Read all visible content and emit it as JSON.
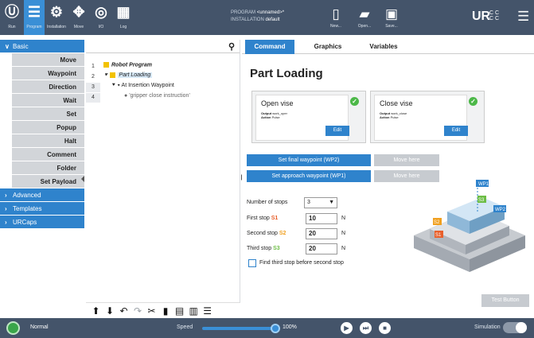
{
  "topbar": {
    "nav": [
      {
        "label": "Run",
        "icon": "ur-logo-icon",
        "glyph": "Ⓤ"
      },
      {
        "label": "Program",
        "icon": "program-icon",
        "glyph": "☰"
      },
      {
        "label": "Installation",
        "icon": "installation-icon",
        "glyph": "⚙"
      },
      {
        "label": "Move",
        "icon": "move-icon",
        "glyph": "✥"
      },
      {
        "label": "I/O",
        "icon": "io-icon",
        "glyph": "◎"
      },
      {
        "label": "Log",
        "icon": "log-icon",
        "glyph": "▦"
      }
    ],
    "program_label": "PROGRAM",
    "program_value": "<unnamed>*",
    "installation_label": "INSTALLATION",
    "installation_value": "default",
    "file_buttons": [
      {
        "label": "New...",
        "glyph": "▯"
      },
      {
        "label": "Open...",
        "glyph": "▰"
      },
      {
        "label": "Save...",
        "glyph": "▣"
      }
    ],
    "logo": "UR",
    "cc": "C C\nC C"
  },
  "sidebar": {
    "basic_label": "Basic",
    "commands": [
      "Move",
      "Waypoint",
      "Direction",
      "Wait",
      "Set",
      "Popup",
      "Halt",
      "Comment",
      "Folder",
      "Set Payload"
    ],
    "categories": [
      "Advanced",
      "Templates",
      "URCaps"
    ]
  },
  "tree": {
    "lines": [
      {
        "num": "1",
        "text": "Robot Program"
      },
      {
        "num": "2",
        "text": "Part Loading"
      },
      {
        "num": "3",
        "text": "At Insertion Waypoint"
      },
      {
        "num": "4",
        "text": "'gripper close instruction'"
      }
    ]
  },
  "tabs": [
    "Command",
    "Graphics",
    "Variables"
  ],
  "main": {
    "title": "Part Loading",
    "cards": [
      {
        "name": "Open vise",
        "output_label": "Output",
        "output_value": "work_oper",
        "action_label": "Action",
        "action_value": "Pulse",
        "edit_label": "Edit"
      },
      {
        "name": "Close vise",
        "output_label": "Output",
        "output_value": "work_close",
        "action_label": "Action",
        "action_value": "Pulse",
        "edit_label": "Edit"
      }
    ],
    "set_final_label": "Set final waypoint (WP2)",
    "set_approach_label": "Set approach waypoint (WP1)",
    "move_here_label": "Move here",
    "num_stops_label": "Number of stops",
    "num_stops_value": "3",
    "first_stop_label": "First stop",
    "first_stop_tag": "S1",
    "first_stop_value": "10",
    "second_stop_label": "Second stop",
    "second_stop_tag": "S2",
    "second_stop_value": "20",
    "third_stop_label": "Third stop",
    "third_stop_tag": "S3",
    "third_stop_value": "20",
    "unit": "N",
    "checkbox_label": "Find third stop before second stop",
    "test_button": "Test Button",
    "diagram_tags": {
      "wp1": "WP1",
      "wp2": "WP2",
      "s1": "S1",
      "s2": "S2",
      "s3": "S3"
    }
  },
  "bottombar": {
    "mode": "Normal",
    "speed_label": "Speed",
    "speed_value": "100%",
    "speed_fraction": 1.0,
    "simulation_label": "Simulation"
  },
  "colors": {
    "accent": "#2f83cc",
    "topbar": "#44546a",
    "check": "#4cb848",
    "s1": "#e8602c",
    "s2": "#f0a020",
    "s3": "#6cbd45"
  }
}
